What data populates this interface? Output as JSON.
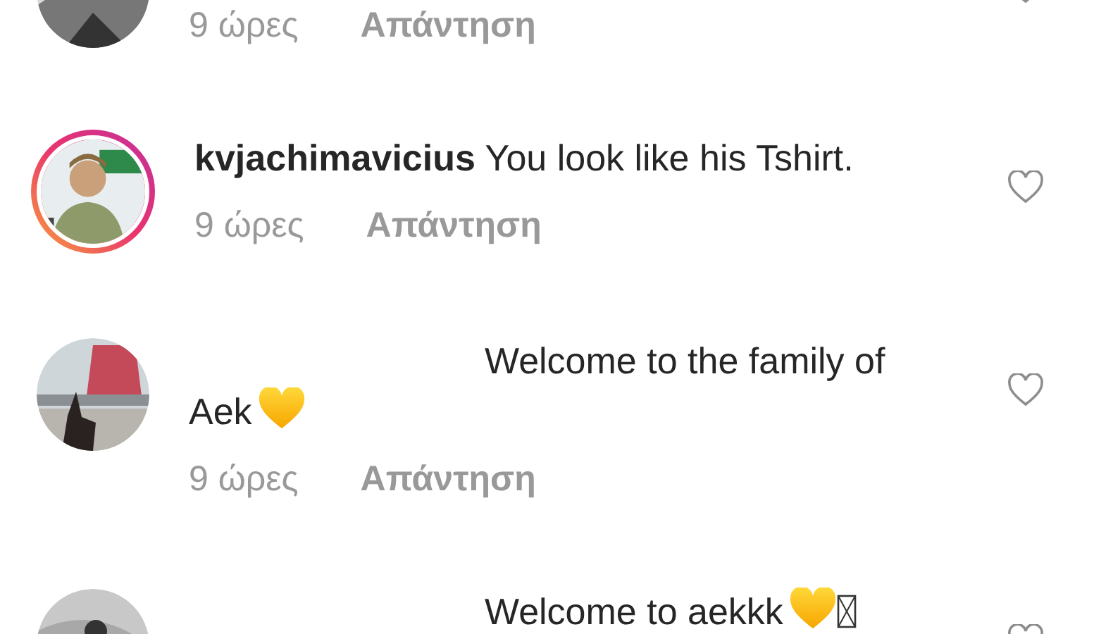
{
  "comments": [
    {
      "kind": "partial",
      "story_ring": false,
      "time": "9 ώρες",
      "reply": "Απάντηση"
    },
    {
      "kind": "named",
      "story_ring": true,
      "username": "kvjachimavicius",
      "text": "You look like his Tshirt.",
      "time": "9 ώρες",
      "reply": "Απάντηση"
    },
    {
      "kind": "hidden_user",
      "story_ring": false,
      "text": "Welcome to the family of Aek",
      "symbols": [
        {
          "kind": "heart"
        }
      ],
      "time": "9 ώρες",
      "reply": "Απάντηση"
    },
    {
      "kind": "hidden_user",
      "story_ring": false,
      "text": "Welcome to aekkk",
      "symbols": [
        {
          "kind": "heart"
        },
        {
          "kind": "missing_glyph"
        }
      ]
    }
  ]
}
